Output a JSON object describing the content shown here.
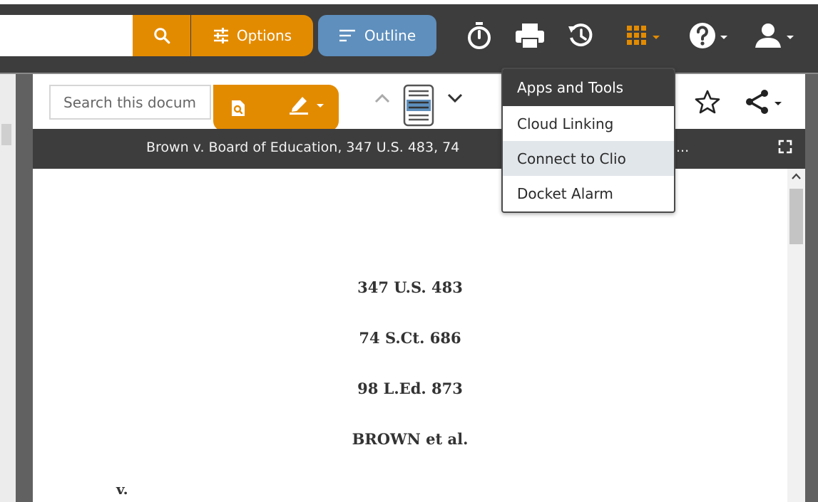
{
  "topbar": {
    "search_value": "",
    "options_label": "Options",
    "outline_label": "Outline"
  },
  "doc_toolbar": {
    "search_placeholder": "Search this document"
  },
  "doc_title": {
    "text": "Brown v. Board of Education, 347 U.S. 483, 74",
    "ellipsis": "..."
  },
  "document": {
    "citation_1": "347 U.S. 483",
    "citation_2": "74 S.Ct. 686",
    "citation_3": "98 L.Ed. 873",
    "party": "BROWN et al.",
    "versus": "v."
  },
  "apps_menu": {
    "header": "Apps and Tools",
    "items": [
      {
        "label": "Cloud Linking"
      },
      {
        "label": "Connect to Clio"
      },
      {
        "label": "Docket Alarm"
      }
    ],
    "hovered_index": 1
  },
  "colors": {
    "brand_orange": "#e38b00",
    "outline_blue": "#5e8fbd",
    "dark_bar": "#3d3d3d"
  },
  "icons": [
    "search-icon",
    "sliders-icon",
    "outline-lines-icon",
    "timer-icon",
    "print-icon",
    "history-icon",
    "apps-grid-icon",
    "help-icon",
    "user-icon",
    "doc-search-icon",
    "highlighter-icon",
    "chevron-up-icon",
    "page-view-icon",
    "chevron-down-icon",
    "star-icon",
    "share-icon",
    "fullscreen-icon"
  ]
}
